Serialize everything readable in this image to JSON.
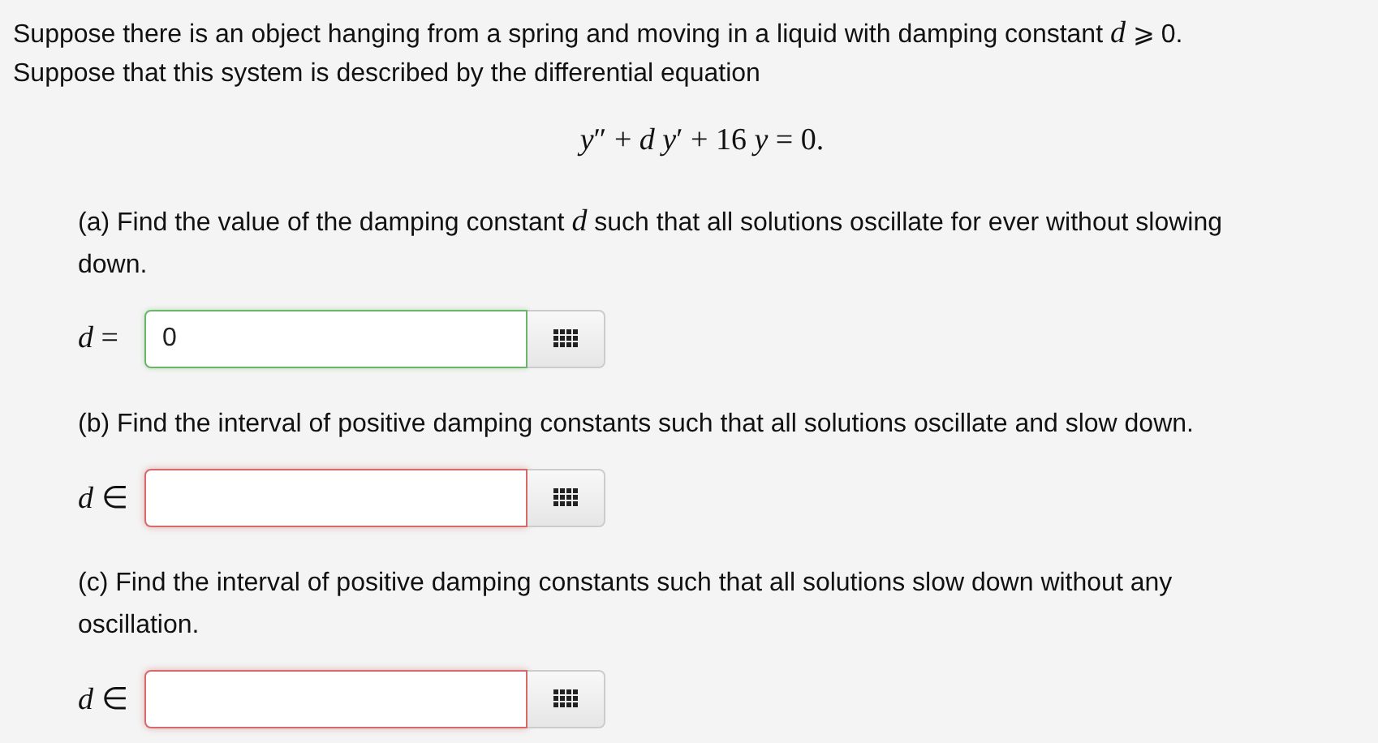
{
  "intro": "Suppose there is an object hanging from a spring and moving in a liquid with damping constant *d* ⩾ 0. Suppose that this system is described by the differential equation",
  "equation": "*y*″ + *d* *y*′ + 16 *y* = 0.",
  "parts": [
    {
      "question": "(a) Find the value of the damping constant *d* such that all solutions oscillate for ever without slowing down.",
      "label": "*d* =",
      "answer": {
        "value": "0",
        "correct": true
      }
    },
    {
      "question": "(b) Find the interval of positive damping constants such that all solutions oscillate and slow down.",
      "label": "*d* ∈",
      "answer": {
        "correct": false
      }
    },
    {
      "question": "(c) Find the interval of positive damping constants such that all solutions slow down without any oscillation.",
      "label": "*d* ∈",
      "answer": {
        "correct": false
      }
    }
  ]
}
